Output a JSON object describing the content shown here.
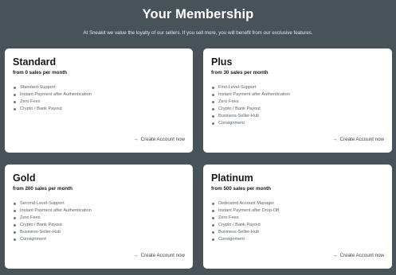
{
  "header": {
    "title": "Your Membership",
    "subtitle": "At Sneakit we value the loyalty of our sellers. If you sell more, you will benefit from our exclusive features."
  },
  "plans": [
    {
      "name": "Standard",
      "requirement": "from 0 sales per month",
      "features": [
        "Standard-Support",
        "Instant Payment after Authentication",
        "Zero Fees",
        "Crypto / Bank Payout"
      ],
      "cta": "Create Account now"
    },
    {
      "name": "Plus",
      "requirement": "from 30 sales per month",
      "features": [
        "First-Level-Support",
        "Instant Payment after Authentication",
        "Zero Fees",
        "Crypto / Bank Payout",
        "Business-Seller-Hub",
        "Consignment"
      ],
      "cta": "Create Account now"
    },
    {
      "name": "Gold",
      "requirement": "from 200 sales per month",
      "features": [
        "Second-Level-Support",
        "Instant Payment after Authentication",
        "Zero Fees",
        "Crypto / Bank Payout",
        "Business-Seller-Hub",
        "Consignment"
      ],
      "cta": "Create Account now"
    },
    {
      "name": "Platinum",
      "requirement": "from 500 sales per month",
      "features": [
        "Dedicated Account Manager",
        "Instant Payment after Drop-Off",
        "Zero Fees",
        "Crypto / Bank Payout",
        "Business-Seller-Hub",
        "Consignment"
      ],
      "cta": "Create Account now"
    }
  ],
  "icons": {
    "cta_arrow": "arrow-right-icon",
    "bullet": "bullet-dot-icon"
  },
  "colors": {
    "background": "#485259",
    "card": "#ffffff",
    "text": "#15191c"
  }
}
